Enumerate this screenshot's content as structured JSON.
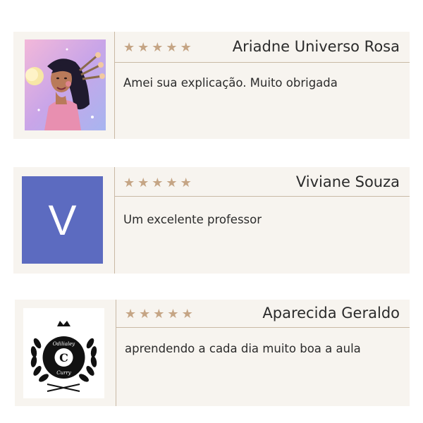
{
  "reviews": [
    {
      "name": "Ariadne Universo Rosa",
      "rating": 5,
      "stars": [
        "★",
        "★",
        "★",
        "★",
        "★"
      ],
      "comment": "Amei sua explicação. Muito obrigada",
      "avatar": {
        "type": "illustration",
        "icon": "woman-portrait-illustration"
      }
    },
    {
      "name": "Viviane Souza",
      "rating": 5,
      "stars": [
        "★",
        "★",
        "★",
        "★",
        "★"
      ],
      "comment": "Um excelente professor",
      "avatar": {
        "type": "letter",
        "letter": "V",
        "color": "#5c6bc0"
      }
    },
    {
      "name": "Aparecida Geraldo",
      "rating": 5,
      "stars": [
        "★",
        "★",
        "★",
        "★",
        "★"
      ],
      "comment": "aprendendo a cada dia muito boa a aula",
      "avatar": {
        "type": "logo",
        "icon": "laurel-crown-logo",
        "logo_text_top": "Odilialey",
        "logo_letter": "C",
        "logo_text_bottom": "Curry"
      }
    }
  ],
  "colors": {
    "card_bg": "#f7f4ef",
    "divider": "#c9b9a5",
    "star": "#c5a585",
    "text": "#2b2b2b"
  }
}
